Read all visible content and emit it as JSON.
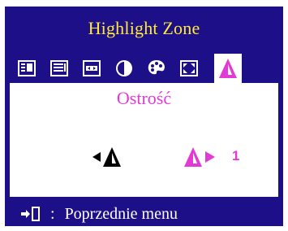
{
  "window": {
    "title": "Highlight Zone"
  },
  "menu": {
    "tabs": [
      {
        "icon": "picture-icon",
        "selected": false
      },
      {
        "icon": "document-icon",
        "selected": false
      },
      {
        "icon": "position-icon",
        "selected": false
      },
      {
        "icon": "contrast-icon",
        "selected": false
      },
      {
        "icon": "color-palette-icon",
        "selected": false
      },
      {
        "icon": "size-icon",
        "selected": false
      },
      {
        "icon": "sharpness-icon",
        "selected": true
      }
    ]
  },
  "setting": {
    "label": "Ostrość",
    "value": "1"
  },
  "footer": {
    "separator": ":",
    "label": "Poprzednie menu"
  },
  "colors": {
    "frame": "#1c0f88",
    "title": "#ffe93a",
    "accent": "#e23ad4",
    "background": "#ffffff"
  }
}
